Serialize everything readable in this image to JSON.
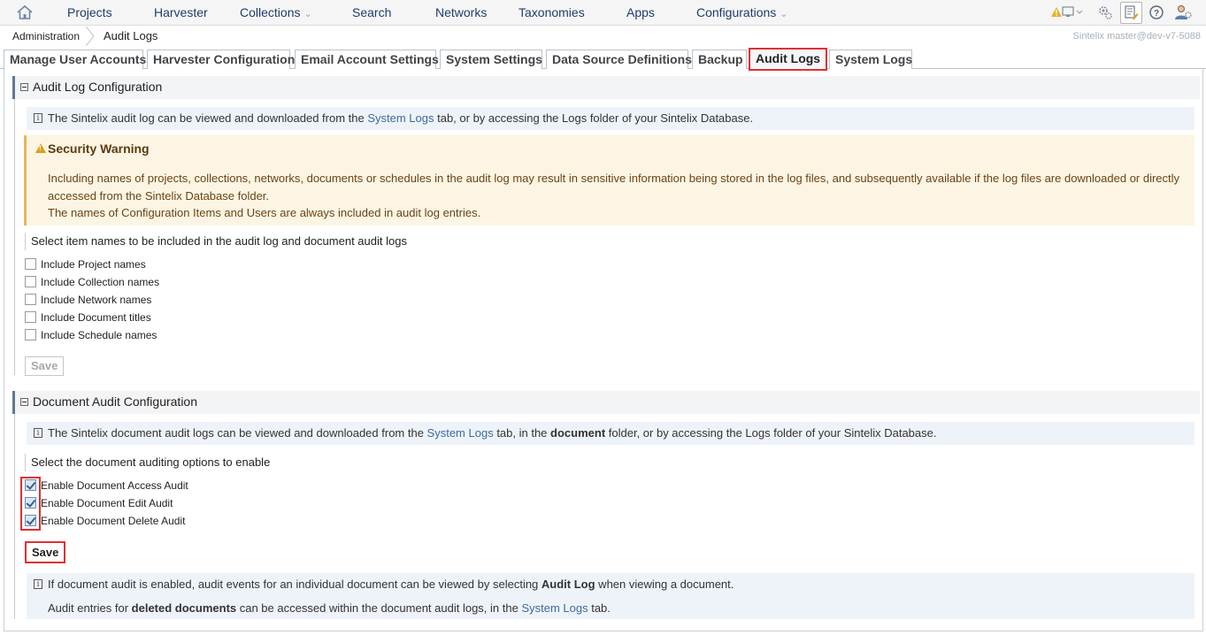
{
  "nav": {
    "items": [
      {
        "label": "Projects"
      },
      {
        "label": "Harvester"
      },
      {
        "label": "Collections"
      },
      {
        "label": "Search"
      },
      {
        "label": "Networks"
      },
      {
        "label": "Taxonomies"
      },
      {
        "label": "Apps"
      },
      {
        "label": "Configurations"
      }
    ],
    "dropdown_glyph": "⌄"
  },
  "breadcrumb": {
    "root": "Administration",
    "current": "Audit Logs"
  },
  "version": "Sintelix master@dev-v7-5088",
  "tabs": [
    {
      "label": "Manage User Accounts"
    },
    {
      "label": "Harvester Configuration"
    },
    {
      "label": "Email Account Settings"
    },
    {
      "label": "System Settings"
    },
    {
      "label": "Data Source Definitions"
    },
    {
      "label": "Backup"
    },
    {
      "label": "Audit Logs",
      "active": true
    },
    {
      "label": "System Logs"
    }
  ],
  "audit_config": {
    "title": "Audit Log Configuration",
    "info_pre": "The Sintelix audit log can be viewed and downloaded from the ",
    "info_link": "System Logs",
    "info_post": " tab, or by accessing the Logs folder of your Sintelix Database.",
    "warning": {
      "title": "Security Warning",
      "line1": "Including names of projects, collections, networks, documents or schedules in the audit log may result in sensitive information being stored in the log files, and subsequently available if the log files are downloaded or directly",
      "line2": "accessed from the Sintelix Database folder.",
      "line3": "The names of Configuration Items and Users are always included in audit log entries."
    },
    "prompt": "Select item names to be included in the audit log and document audit logs",
    "options": [
      {
        "label": "Include Project names",
        "checked": false
      },
      {
        "label": "Include Collection names",
        "checked": false
      },
      {
        "label": "Include Network names",
        "checked": false
      },
      {
        "label": "Include Document titles",
        "checked": false
      },
      {
        "label": "Include Schedule names",
        "checked": false
      }
    ],
    "save_label": "Save"
  },
  "doc_audit": {
    "title": "Document Audit Configuration",
    "info_pre": "The Sintelix document audit logs can be viewed and downloaded from the ",
    "info_link": "System Logs",
    "info_mid": " tab, in the ",
    "info_bold": "document",
    "info_post": " folder, or by accessing the Logs folder of your Sintelix Database.",
    "prompt": "Select the document auditing options to enable",
    "options": [
      {
        "label": "Enable Document Access Audit",
        "checked": true
      },
      {
        "label": "Enable Document Edit Audit",
        "checked": true
      },
      {
        "label": "Enable Document Delete Audit",
        "checked": true
      }
    ],
    "save_label": "Save",
    "note1_pre": "If document audit is enabled, audit events for an individual document can be viewed by selecting ",
    "note1_bold": "Audit Log",
    "note1_post": " when viewing a document.",
    "note2_pre": "Audit entries for ",
    "note2_bold": "deleted documents",
    "note2_mid": " can be accessed within the document audit logs, in the ",
    "note2_link": "System Logs",
    "note2_post": " tab."
  },
  "icons": [
    "home-icon",
    "warning-monitor-icon",
    "settings-icon",
    "document-edit-icon",
    "help-icon",
    "user-settings-icon"
  ],
  "colors": {
    "highlight": "#e03030",
    "link": "#3f6aa2",
    "nav_text": "#1f3c6e",
    "warning_bg": "#fdf5e3",
    "info_bg": "#eef3fa"
  }
}
